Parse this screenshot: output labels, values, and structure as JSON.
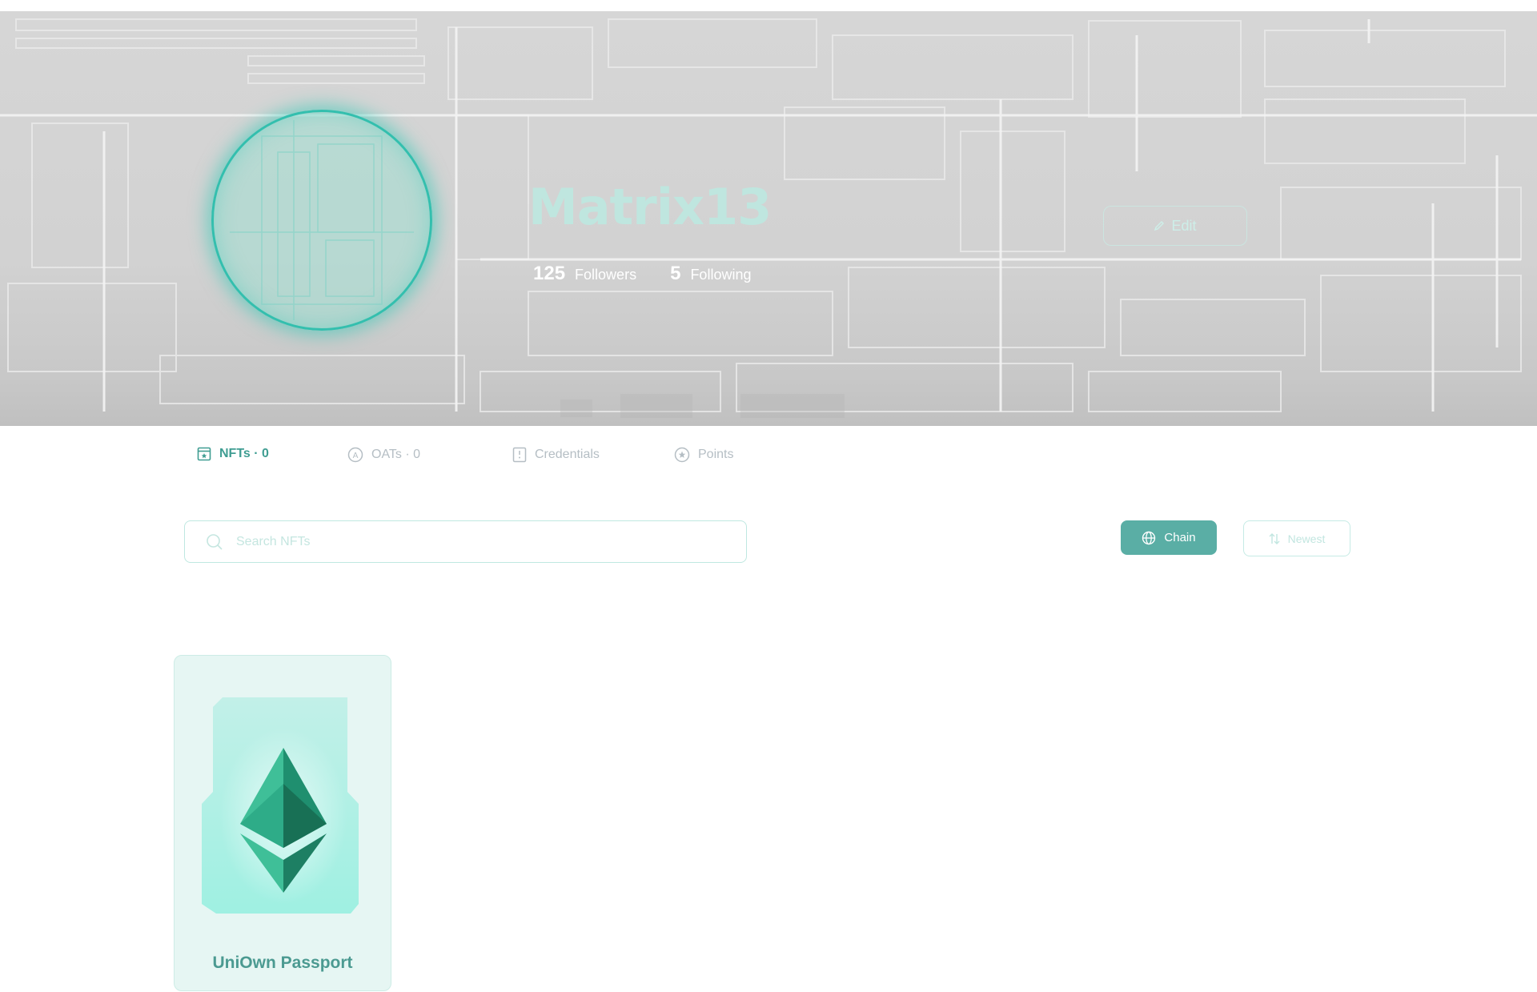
{
  "profile": {
    "username": "Matrix13",
    "followers_count": "125",
    "followers_label": "Followers",
    "following_count": "5",
    "following_label": "Following",
    "edit_label": "Edit"
  },
  "tabs": [
    {
      "label": "NFTs · 0",
      "icon": "nft-icon",
      "active": true
    },
    {
      "label": "OATs · 0",
      "icon": "oat-icon",
      "active": false
    },
    {
      "label": "Credentials",
      "icon": "credentials-icon",
      "active": false
    },
    {
      "label": "Points",
      "icon": "points-icon",
      "active": false
    }
  ],
  "search": {
    "placeholder": "Search NFTs"
  },
  "filters": {
    "chain_label": "Chain",
    "sort_label": "Newest"
  },
  "nfts": [
    {
      "title": "UniOwn Passport",
      "image": "ethereum-logo"
    }
  ],
  "colors": {
    "accent": "#5aaea5",
    "accent_text": "#3f9d92",
    "avatar_ring": "#33bfae",
    "card_bg": "#e6f6f3"
  }
}
